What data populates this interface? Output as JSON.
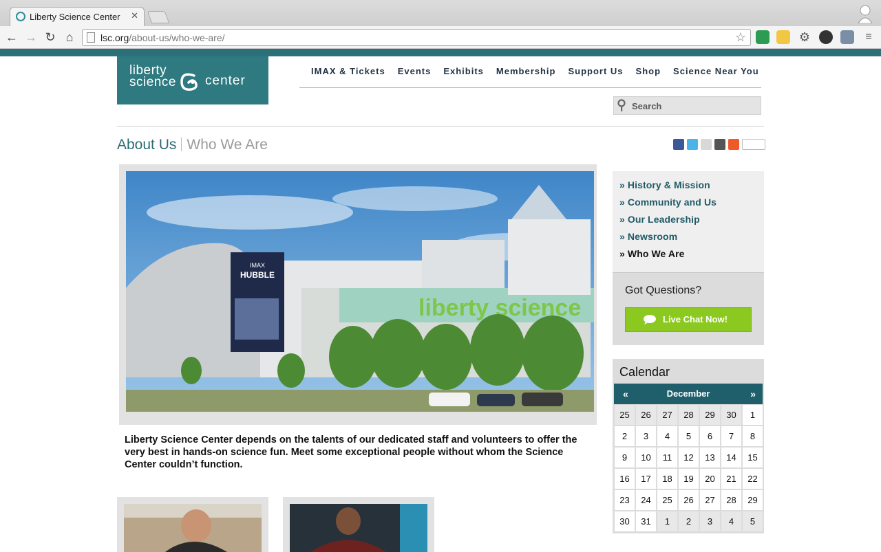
{
  "browser": {
    "tab_title": "Liberty Science Center",
    "tab_close": "✕",
    "url_host": "lsc.org",
    "url_path": "/about-us/who-we-are/"
  },
  "site": {
    "logo_line1": "liberty",
    "logo_line2": "science",
    "logo_line3": "center",
    "nav": [
      "IMAX & Tickets",
      "Events",
      "Exhibits",
      "Membership",
      "Support Us",
      "Shop",
      "Science Near You"
    ],
    "search_placeholder": "Search"
  },
  "breadcrumb": {
    "section": "About Us",
    "page": "Who We Are"
  },
  "intro_text": "Liberty Science Center depends on the talents of our dedicated staff and volunteers to offer the very best in hands-on science fun. Meet some exceptional people without whom the Science Center couldn’t function.",
  "hero_banner": {
    "line1": "IMAX",
    "line2": "HUBBLE",
    "building_sign": "liberty science"
  },
  "sidebar": {
    "links": [
      {
        "label": "» History & Mission",
        "current": false
      },
      {
        "label": "» Community and Us",
        "current": false
      },
      {
        "label": "» Our Leadership",
        "current": false
      },
      {
        "label": "» Newsroom",
        "current": false
      },
      {
        "label": "» Who We Are",
        "current": true
      }
    ],
    "questions_title": "Got Questions?",
    "chat_label": "Live Chat Now!"
  },
  "calendar": {
    "title": "Calendar",
    "prev": "«",
    "next": "»",
    "month": "December",
    "days": [
      [
        "25",
        "26",
        "27",
        "28",
        "29",
        "30",
        "1"
      ],
      [
        "2",
        "3",
        "4",
        "5",
        "6",
        "7",
        "8"
      ],
      [
        "9",
        "10",
        "11",
        "12",
        "13",
        "14",
        "15"
      ],
      [
        "16",
        "17",
        "18",
        "19",
        "20",
        "21",
        "22"
      ],
      [
        "23",
        "24",
        "25",
        "26",
        "27",
        "28",
        "29"
      ],
      [
        "30",
        "31",
        "1",
        "2",
        "3",
        "4",
        "5"
      ]
    ]
  },
  "colors": {
    "brand_teal": "#2e7a80",
    "nav_dark": "#1e5f6b",
    "chat_green": "#8cc920"
  }
}
